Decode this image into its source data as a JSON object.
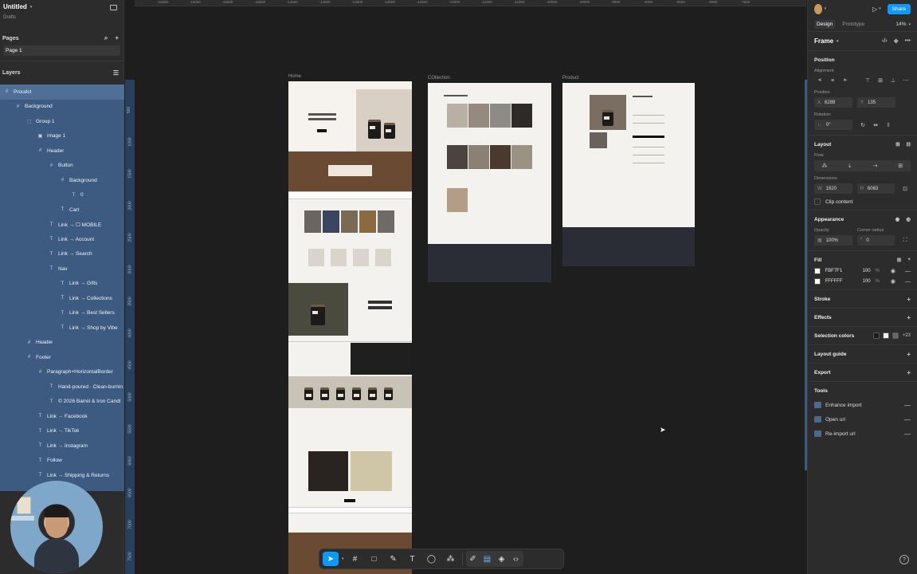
{
  "file": {
    "title": "Untitled",
    "location": "Drafts"
  },
  "pages": {
    "header": "Pages",
    "items": [
      "Page 1"
    ]
  },
  "layers": {
    "header": "Layers",
    "items": [
      {
        "label": "Proudct",
        "icon": "frame",
        "indent": 0,
        "selected": true
      },
      {
        "label": "Background",
        "icon": "frame",
        "indent": 1
      },
      {
        "label": "Group 1",
        "icon": "group",
        "indent": 2
      },
      {
        "label": "image 1",
        "icon": "image",
        "indent": 3
      },
      {
        "label": "Header",
        "icon": "frame",
        "indent": 3
      },
      {
        "label": "Button",
        "icon": "frame",
        "indent": 4
      },
      {
        "label": "Background",
        "icon": "frame",
        "indent": 5
      },
      {
        "label": "0",
        "icon": "text",
        "indent": 6
      },
      {
        "label": "Cart",
        "icon": "text",
        "indent": 5
      },
      {
        "label": "Link → ☐ MOBILE",
        "icon": "text",
        "indent": 4
      },
      {
        "label": "Link → Account",
        "icon": "text",
        "indent": 4
      },
      {
        "label": "Link → Search",
        "icon": "text",
        "indent": 4
      },
      {
        "label": "Nav",
        "icon": "text",
        "indent": 4
      },
      {
        "label": "Link → Gifts",
        "icon": "text",
        "indent": 5
      },
      {
        "label": "Link → Collections",
        "icon": "text",
        "indent": 5
      },
      {
        "label": "Link → Best Sellers",
        "icon": "text",
        "indent": 5
      },
      {
        "label": "Link → Shop by Vibe",
        "icon": "text",
        "indent": 5
      },
      {
        "label": "Header",
        "icon": "frame",
        "indent": 2
      },
      {
        "label": "Footer",
        "icon": "frame",
        "indent": 2
      },
      {
        "label": "Paragraph+HorizontalBorder",
        "icon": "frame",
        "indent": 3
      },
      {
        "label": "Hand-poured · Clean-burnin",
        "icon": "text",
        "indent": 4
      },
      {
        "label": "© 2026 Barrel & Iron Candl",
        "icon": "text",
        "indent": 4
      },
      {
        "label": "Link → Facebook",
        "icon": "text",
        "indent": 3
      },
      {
        "label": "Link → TikTok",
        "icon": "text",
        "indent": 3
      },
      {
        "label": "Link → Instagram",
        "icon": "text",
        "indent": 3
      },
      {
        "label": "Follow",
        "icon": "text",
        "indent": 3
      },
      {
        "label": "Link → Shipping & Returns",
        "icon": "text",
        "indent": 3
      }
    ]
  },
  "ruler": {
    "top": [
      "-16500",
      "-16000",
      "-15500",
      "-15000",
      "-14500",
      "-14000",
      "-13500",
      "-13000",
      "-12500",
      "-12000",
      "-11500",
      "-11000",
      "-10500",
      "-10000",
      "-9500",
      "-9000",
      "-8500",
      "-8000",
      "-7500"
    ],
    "left": [
      "500",
      "1000",
      "1500",
      "2000",
      "2500",
      "3000",
      "3500",
      "4000",
      "4500",
      "5000",
      "5500",
      "6063",
      "6500",
      "7000",
      "7500"
    ]
  },
  "canvas": {
    "frames": [
      {
        "label": "Home"
      },
      {
        "label": "COllection"
      },
      {
        "label": "Product"
      }
    ]
  },
  "toolbar": {
    "tools": [
      "move",
      "frame",
      "shape",
      "pen",
      "text",
      "comment",
      "actions"
    ]
  },
  "right": {
    "share_label": "Share",
    "tabs": [
      "Design",
      "Prototype"
    ],
    "zoom": "14%",
    "frame_label": "Frame",
    "position": {
      "title": "Position",
      "alignment_label": "Alignment",
      "position_label": "Position",
      "x_label": "X",
      "x": "6289",
      "y_label": "Y",
      "y": "135",
      "rotation_label": "Rotation",
      "rotation": "0°"
    },
    "layout": {
      "title": "Layout",
      "flow_label": "Flow",
      "dimensions_label": "Dimensions",
      "w_label": "W",
      "w": "1920",
      "h_label": "H",
      "h": "6063",
      "clip_label": "Clip content"
    },
    "appearance": {
      "title": "Appearance",
      "opacity_label": "Opacity",
      "opacity": "100%",
      "radius_label": "Corner radius",
      "radius": "0"
    },
    "fill": {
      "title": "Fill",
      "items": [
        {
          "hex": "FBF7F1",
          "color": "#FBF7F1",
          "opacity": "100",
          "unit": "%"
        },
        {
          "hex": "FFFFFF",
          "color": "#FFFFFF",
          "opacity": "100",
          "unit": "%"
        }
      ]
    },
    "stroke_title": "Stroke",
    "effects_title": "Effects",
    "selection_colors": {
      "title": "Selection colors",
      "more": "+23",
      "colors": [
        "#1e1e1e",
        "#f0f0f0",
        "#6b6560"
      ]
    },
    "layout_guide_title": "Layout guide",
    "export_title": "Export",
    "tools": {
      "title": "Tools",
      "items": [
        "Enhance import",
        "Open url",
        "Re-import url"
      ]
    }
  }
}
